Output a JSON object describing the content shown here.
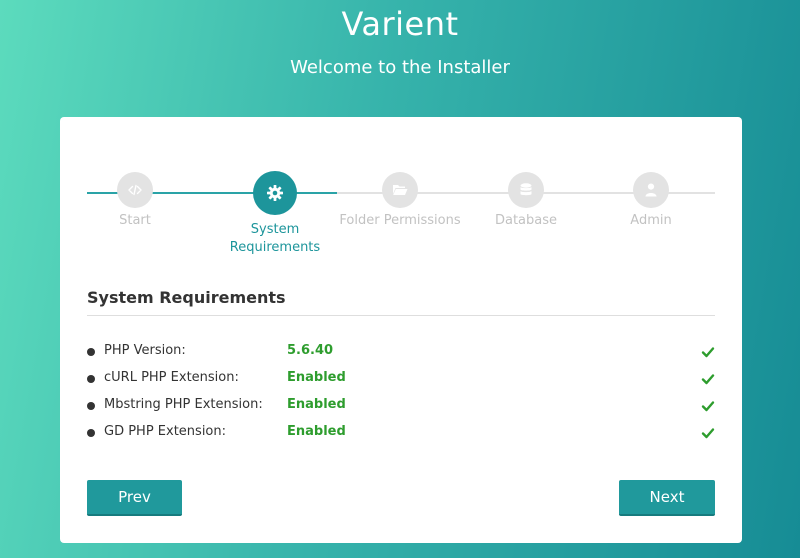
{
  "header": {
    "title": "Varient",
    "subtitle": "Welcome to the Installer"
  },
  "steps": [
    {
      "label": "Start",
      "icon": "code-icon",
      "state": "done"
    },
    {
      "label": "System Requirements",
      "icon": "gear-icon",
      "state": "current"
    },
    {
      "label": "Folder Permissions",
      "icon": "folder-open-icon",
      "state": "pending"
    },
    {
      "label": "Database",
      "icon": "database-icon",
      "state": "pending"
    },
    {
      "label": "Admin",
      "icon": "user-icon",
      "state": "pending"
    }
  ],
  "section": {
    "title": "System Requirements"
  },
  "requirements": [
    {
      "name": "PHP Version:",
      "value": "5.6.40",
      "status": "ok"
    },
    {
      "name": "cURL PHP Extension:",
      "value": "Enabled",
      "status": "ok"
    },
    {
      "name": "Mbstring PHP Extension:",
      "value": "Enabled",
      "status": "ok"
    },
    {
      "name": "GD PHP Extension:",
      "value": "Enabled",
      "status": "ok"
    }
  ],
  "buttons": {
    "prev": "Prev",
    "next": "Next"
  },
  "colors": {
    "accent": "#1d959b",
    "success": "#2e9d2e",
    "inactive": "#e3e3e3"
  }
}
